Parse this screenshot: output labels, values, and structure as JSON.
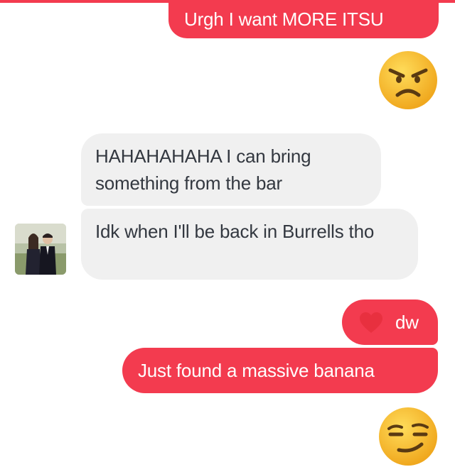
{
  "messages": {
    "out_1": "Urgh I want MORE ITSU",
    "in_1": "HAHAHAHAHA I can bring something from the bar",
    "in_2": "Idk when I'll be back in Burrells tho",
    "out_2": "dw",
    "out_3": "Just found a massive banana"
  },
  "reactions": {
    "angry": "angry-face-emoji",
    "heart": "heart-icon",
    "smirk": "smirking-face-emoji"
  },
  "colors": {
    "outgoing_bubble": "#f33b4f",
    "incoming_bubble": "#f0f0f0",
    "incoming_text": "#333840",
    "emoji_yellow": "#f7c02c"
  }
}
